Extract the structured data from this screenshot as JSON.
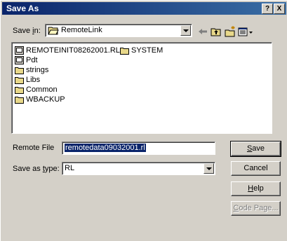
{
  "window": {
    "title": "Save As",
    "help_btn": "?",
    "close_btn": "X"
  },
  "save_in": {
    "label_pre": "Save ",
    "label_key": "i",
    "label_post": "n:",
    "value": "RemoteLink"
  },
  "toolbar": {
    "icons": [
      "back-icon",
      "up-folder-icon",
      "new-folder-icon",
      "view-menu-icon"
    ]
  },
  "files": [
    {
      "name": "REMOTEINIT08262001.RL",
      "icon": "rl-file-icon"
    },
    {
      "name": "SYSTEM",
      "icon": "folder-icon"
    },
    {
      "name": "Pdt",
      "icon": "rl-file-icon"
    },
    {
      "name": "strings",
      "icon": "folder-icon"
    },
    {
      "name": "Libs",
      "icon": "folder-icon"
    },
    {
      "name": "Common",
      "icon": "folder-icon"
    },
    {
      "name": "WBACKUP",
      "icon": "folder-icon"
    }
  ],
  "remote_file": {
    "label": "Remote File",
    "value": "remotedata09032001.rl"
  },
  "save_as_type": {
    "label_pre": "Save as ",
    "label_key": "t",
    "label_post": "ype:",
    "value": "RL"
  },
  "buttons": {
    "save_key": "S",
    "save_rest": "ave",
    "cancel": "Cancel",
    "help_key": "H",
    "help_rest": "elp",
    "codepage_key": "C",
    "codepage_rest": "ode Page..."
  }
}
